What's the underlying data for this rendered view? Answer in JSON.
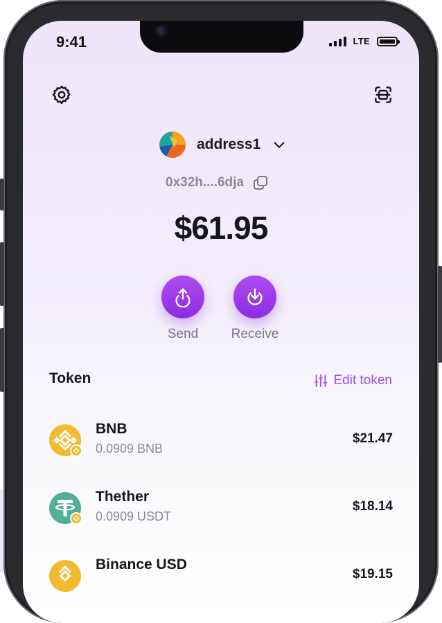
{
  "status_bar": {
    "time": "9:41",
    "network": "LTE"
  },
  "wallet": {
    "account_name": "address1",
    "address": "0x32h....6dja",
    "balance": "$61.95"
  },
  "actions": {
    "send_label": "Send",
    "receive_label": "Receive"
  },
  "tokens": {
    "title": "Token",
    "edit_label": "Edit token",
    "items": [
      {
        "name": "BNB",
        "amount": "0.0909 BNB",
        "value": "$21.47",
        "icon": "bnb-icon"
      },
      {
        "name": "Thether",
        "amount": "0.0909 USDT",
        "value": "$18.14",
        "icon": "tether-icon"
      },
      {
        "name": "Binance USD",
        "amount": "",
        "value": "$19.15",
        "icon": "binance-usd-icon"
      }
    ]
  },
  "colors": {
    "accent": "#9b3ff0",
    "edit_link": "#a24de8",
    "bnb": "#f3ba2f",
    "tether": "#50af95"
  }
}
